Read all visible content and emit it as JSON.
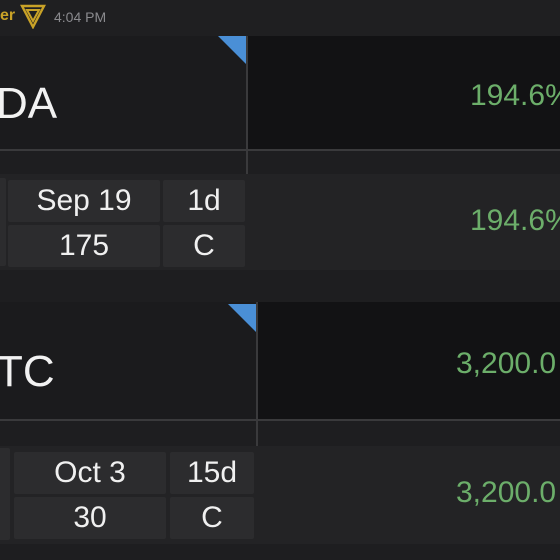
{
  "header": {
    "author_fragment": "er",
    "time": "4:04 PM"
  },
  "cards": [
    {
      "symbol": "DA",
      "price_main": "194.6%",
      "price_row": "194.6%",
      "expiry": "Sep 19",
      "strike": "175",
      "dte": "1d",
      "type": "C"
    },
    {
      "symbol": "TC",
      "price_main": "3,200.0",
      "price_row": "3,200.0",
      "expiry": "Oct 3",
      "strike": "30",
      "dte": "15d",
      "type": "C"
    }
  ],
  "colors": {
    "price_green": "#6cae6a",
    "flag_blue": "#4a8fd6",
    "badge_gold": "#c9a227"
  }
}
